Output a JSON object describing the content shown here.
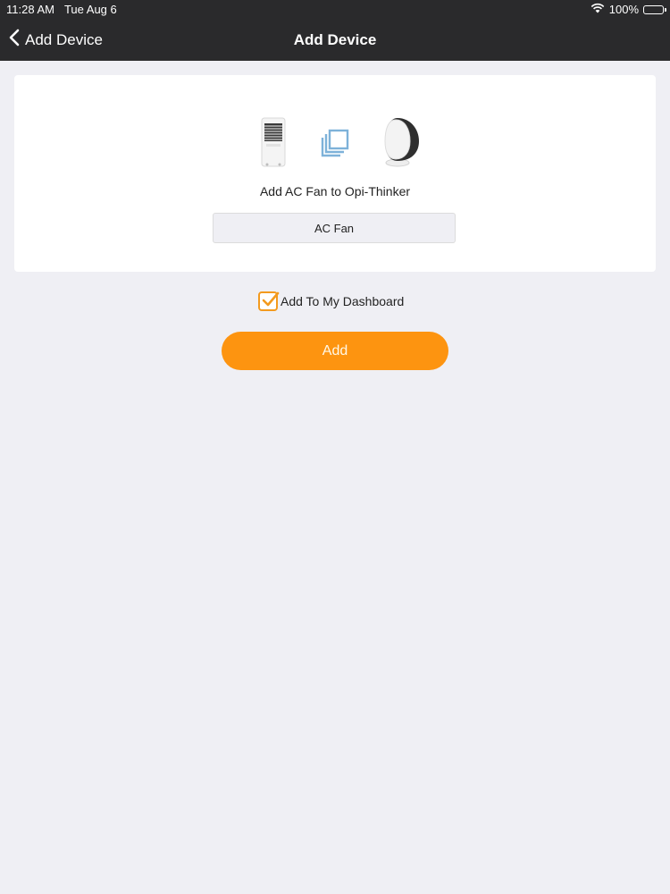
{
  "status_bar": {
    "time": "11:28 AM",
    "date": "Tue Aug 6",
    "battery": "100%",
    "wifi_icon": "wifi-icon",
    "battery_icon": "battery-icon"
  },
  "nav": {
    "back_label": "Add Device",
    "back_icon": "chevron-left-icon",
    "title": "Add Device"
  },
  "card": {
    "caption": "Add AC Fan to Opi-Thinker",
    "device_name_value": "AC Fan",
    "icons": [
      "ac-fan-device-icon",
      "link-icon",
      "hub-device-icon"
    ]
  },
  "dashboard": {
    "label": "Add To My Dashboard",
    "checked": true
  },
  "actions": {
    "add_label": "Add"
  },
  "colors": {
    "accent": "#fd9410",
    "nav_bg": "#2a2a2c",
    "page_bg": "#efeff4"
  }
}
